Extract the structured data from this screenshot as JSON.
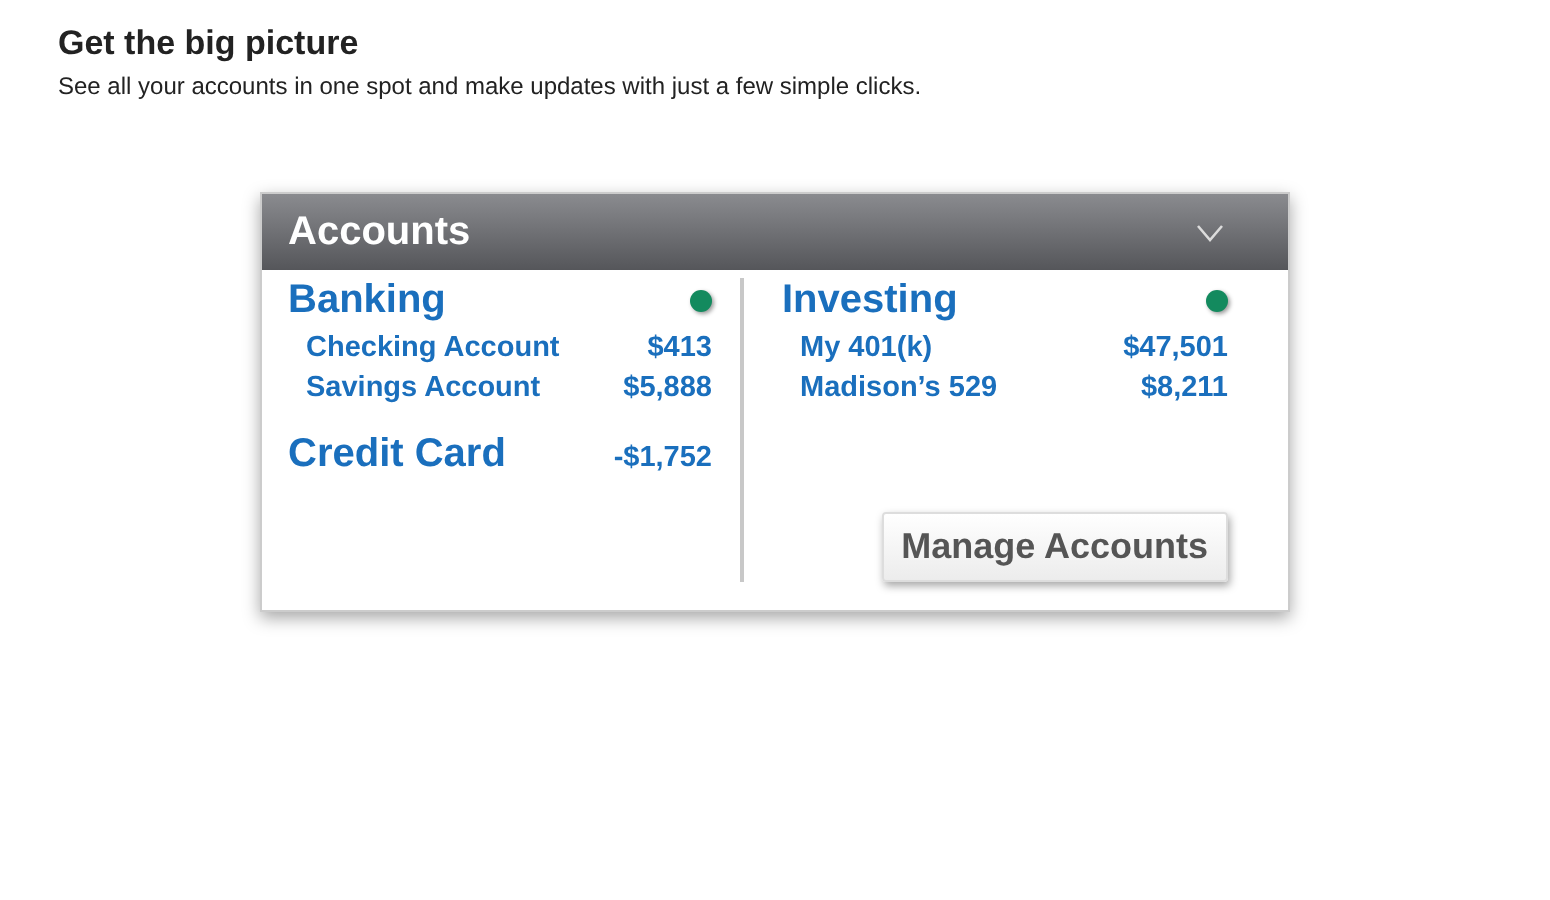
{
  "intro": {
    "title": "Get the big picture",
    "subtitle": "See all your accounts in one spot and make updates with just a few simple clicks."
  },
  "panel": {
    "title": "Accounts",
    "columns": [
      {
        "sections": [
          {
            "kind": "group",
            "name": "Banking",
            "color": "#138a5e",
            "accounts": [
              {
                "name": "Checking Account",
                "amount": "$413"
              },
              {
                "name": "Savings Account",
                "amount": "$5,888"
              }
            ]
          },
          {
            "kind": "single",
            "name": "Credit Card",
            "amount": "-$1,752"
          }
        ]
      },
      {
        "sections": [
          {
            "kind": "group",
            "name": "Investing",
            "color": "#138a5e",
            "accounts": [
              {
                "name": "My 401(k)",
                "amount": "$47,501"
              },
              {
                "name": "Madison’s 529",
                "amount": "$8,211"
              }
            ]
          }
        ],
        "button": "Manage Accounts"
      }
    ]
  }
}
